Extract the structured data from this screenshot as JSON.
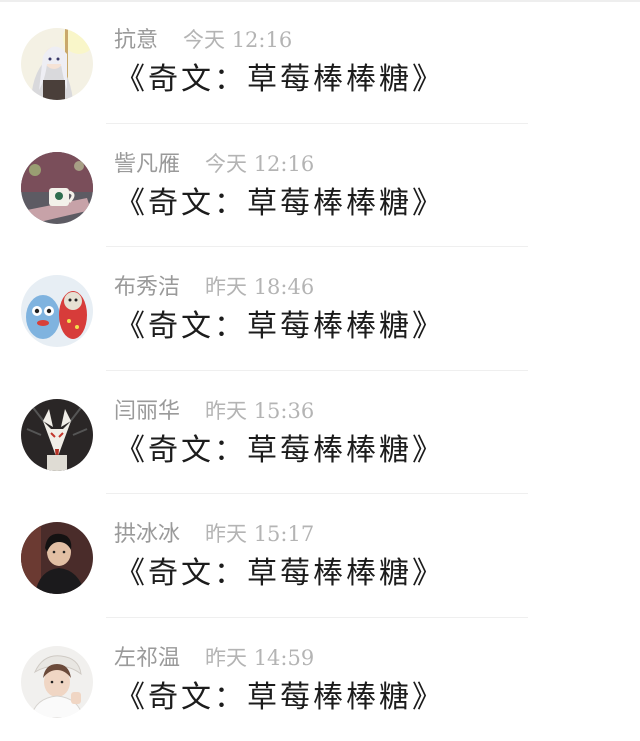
{
  "comments": [
    {
      "name": "抗意",
      "time": "今天 12:16",
      "content": "《奇文：草莓棒棒糖》",
      "avatar_icon": "anime-girl-avatar-icon"
    },
    {
      "name": "訾凡雁",
      "time": "今天 12:16",
      "content": "《奇文：草莓棒棒糖》",
      "avatar_icon": "coffee-cup-avatar-icon"
    },
    {
      "name": "布秀洁",
      "time": "昨天 18:46",
      "content": "《奇文：草莓棒棒糖》",
      "avatar_icon": "plush-toys-avatar-icon"
    },
    {
      "name": "闫丽华",
      "time": "昨天 15:36",
      "content": "《奇文：草莓棒棒糖》",
      "avatar_icon": "fox-mask-avatar-icon"
    },
    {
      "name": "拱冰冰",
      "time": "昨天 15:17",
      "content": "《奇文：草莓棒棒糖》",
      "avatar_icon": "man-portrait-avatar-icon"
    },
    {
      "name": "左祁温",
      "time": "昨天 14:59",
      "content": "《奇文：草莓棒棒糖》",
      "avatar_icon": "boy-portrait-avatar-icon"
    }
  ]
}
